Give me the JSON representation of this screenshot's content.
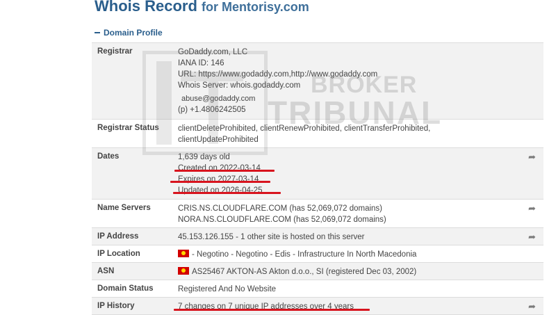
{
  "header": {
    "title_main": "Whois Record",
    "title_for": "for Mentorisy.com"
  },
  "section": {
    "label": "Domain Profile"
  },
  "watermark": {
    "line1": "BROKER",
    "line2": "TRIBUNAL"
  },
  "rows": {
    "registrar": {
      "label": "Registrar",
      "lines": [
        "GoDaddy.com, LLC",
        "IANA ID: 146",
        "URL: https://www.godaddy.com,http://www.godaddy.com",
        "Whois Server: whois.godaddy.com",
        "abuse@godaddy.com",
        "(p) +1.4806242505"
      ]
    },
    "registrar_status": {
      "label": "Registrar Status",
      "lines": [
        "clientDeleteProhibited, clientRenewProhibited, clientTransferProhibited,",
        "clientUpdateProhibited"
      ]
    },
    "dates": {
      "label": "Dates",
      "lines": [
        "1,639 days old",
        "Created on 2022-03-14",
        "Expires on 2027-03-14",
        "Updated on 2026-04-25"
      ]
    },
    "name_servers": {
      "label": "Name Servers",
      "lines": [
        "CRIS.NS.CLOUDFLARE.COM (has 52,069,072 domains)",
        "NORA.NS.CLOUDFLARE.COM (has 52,069,072 domains)"
      ]
    },
    "ip_address": {
      "label": "IP Address",
      "value": "45.153.126.155 - 1 other site is hosted on this server"
    },
    "ip_location": {
      "label": "IP Location",
      "value": "- Negotino - Negotino - Edis - Infrastructure In North Macedonia"
    },
    "asn": {
      "label": "ASN",
      "value": "AS25467 AKTON-AS Akton d.o.o., SI (registered Dec 03, 2002)"
    },
    "domain_status": {
      "label": "Domain Status",
      "value": "Registered And No Website"
    },
    "ip_history": {
      "label": "IP History",
      "value": "7 changes on 7 unique IP addresses over 4 years"
    }
  },
  "colors": {
    "title": "#2a5e8c",
    "row_alt": "#f2f2f2",
    "annotation_underline": "#d8141e",
    "flag": "#d20000"
  },
  "icons": {
    "share": "share-arrow-icon",
    "flag": "north-macedonia-flag-icon",
    "section_toggle": "minus-icon"
  }
}
